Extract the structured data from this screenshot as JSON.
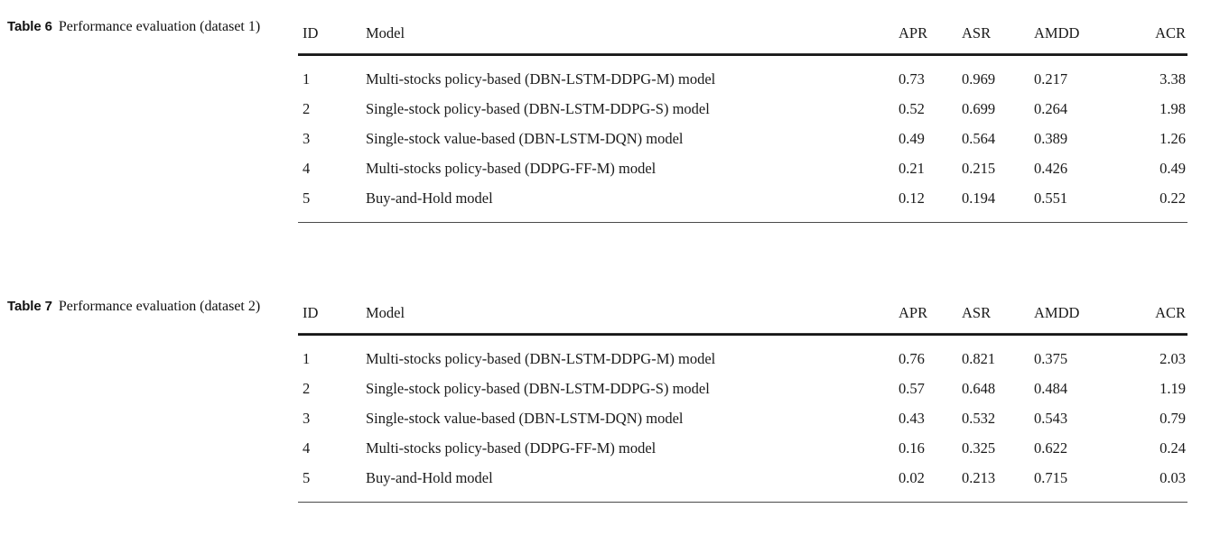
{
  "page": {
    "background_color": "#ffffff",
    "text_color": "#1a1a1a",
    "rule_color": "#171717"
  },
  "tables": [
    {
      "id": "table-6",
      "caption_label": "Table 6",
      "caption_text": "Performance evaluation (dataset 1)",
      "caption_line1": "Performance evaluation",
      "caption_line2": "(dataset 1)",
      "columns": [
        "ID",
        "Model",
        "APR",
        "ASR",
        "AMDD",
        "ACR"
      ],
      "rows": [
        {
          "id": "1",
          "model": "Multi-stocks policy-based (DBN-LSTM-DDPG-M) model",
          "apr": "0.73",
          "asr": "0.969",
          "amdd": "0.217",
          "acr": "3.38"
        },
        {
          "id": "2",
          "model": "Single-stock policy-based (DBN-LSTM-DDPG-S) model",
          "apr": "0.52",
          "asr": "0.699",
          "amdd": "0.264",
          "acr": "1.98"
        },
        {
          "id": "3",
          "model": "Single-stock value-based (DBN-LSTM-DQN) model",
          "apr": "0.49",
          "asr": "0.564",
          "amdd": "0.389",
          "acr": "1.26"
        },
        {
          "id": "4",
          "model": "Multi-stocks policy-based (DDPG-FF-M) model",
          "apr": "0.21",
          "asr": "0.215",
          "amdd": "0.426",
          "acr": "0.49"
        },
        {
          "id": "5",
          "model": "Buy-and-Hold model",
          "apr": "0.12",
          "asr": "0.194",
          "amdd": "0.551",
          "acr": "0.22"
        }
      ]
    },
    {
      "id": "table-7",
      "caption_label": "Table 7",
      "caption_text": "Performance evaluation (dataset 2)",
      "caption_line1": "Performance evaluation",
      "caption_line2": "(dataset 2)",
      "columns": [
        "ID",
        "Model",
        "APR",
        "ASR",
        "AMDD",
        "ACR"
      ],
      "rows": [
        {
          "id": "1",
          "model": "Multi-stocks policy-based (DBN-LSTM-DDPG-M) model",
          "apr": "0.76",
          "asr": "0.821",
          "amdd": "0.375",
          "acr": "2.03"
        },
        {
          "id": "2",
          "model": "Single-stock policy-based (DBN-LSTM-DDPG-S) model",
          "apr": "0.57",
          "asr": "0.648",
          "amdd": "0.484",
          "acr": "1.19"
        },
        {
          "id": "3",
          "model": "Single-stock value-based (DBN-LSTM-DQN) model",
          "apr": "0.43",
          "asr": "0.532",
          "amdd": "0.543",
          "acr": "0.79"
        },
        {
          "id": "4",
          "model": "Multi-stocks policy-based (DDPG-FF-M) model",
          "apr": "0.16",
          "asr": "0.325",
          "amdd": "0.622",
          "acr": "0.24"
        },
        {
          "id": "5",
          "model": "Buy-and-Hold model",
          "apr": "0.02",
          "asr": "0.213",
          "amdd": "0.715",
          "acr": "0.03"
        }
      ]
    }
  ]
}
